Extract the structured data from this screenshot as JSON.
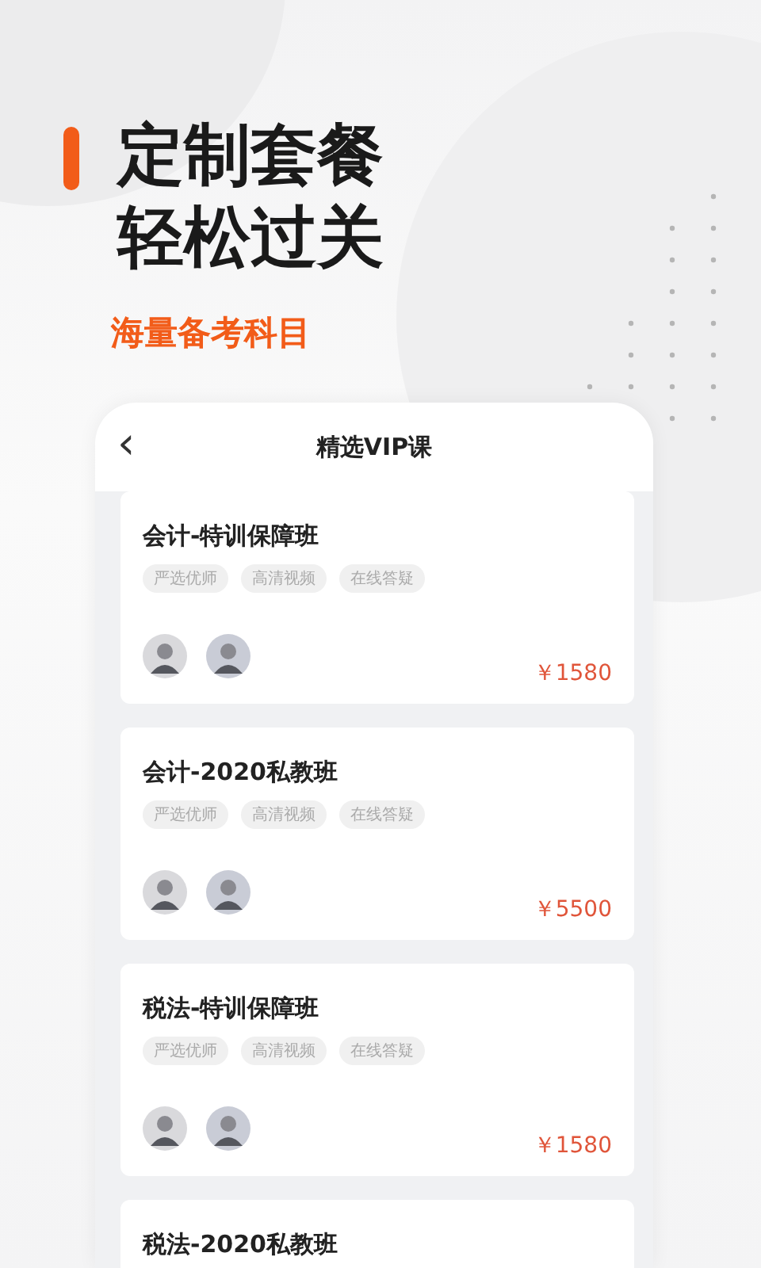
{
  "headline": [
    "定制套餐",
    "轻松过关"
  ],
  "subtitle": "海量备考科目",
  "phone": {
    "back_glyph": "‹",
    "title": "精选VIP课"
  },
  "courses": [
    {
      "title": "会计-特训保障班",
      "tags": [
        "严选优师",
        "高清视频",
        "在线答疑"
      ],
      "price": "￥1580"
    },
    {
      "title": "会计-2020私教班",
      "tags": [
        "严选优师",
        "高清视频",
        "在线答疑"
      ],
      "price": "￥5500"
    },
    {
      "title": "税法-特训保障班",
      "tags": [
        "严选优师",
        "高清视频",
        "在线答疑"
      ],
      "price": "￥1580"
    },
    {
      "title": "税法-2020私教班"
    }
  ]
}
